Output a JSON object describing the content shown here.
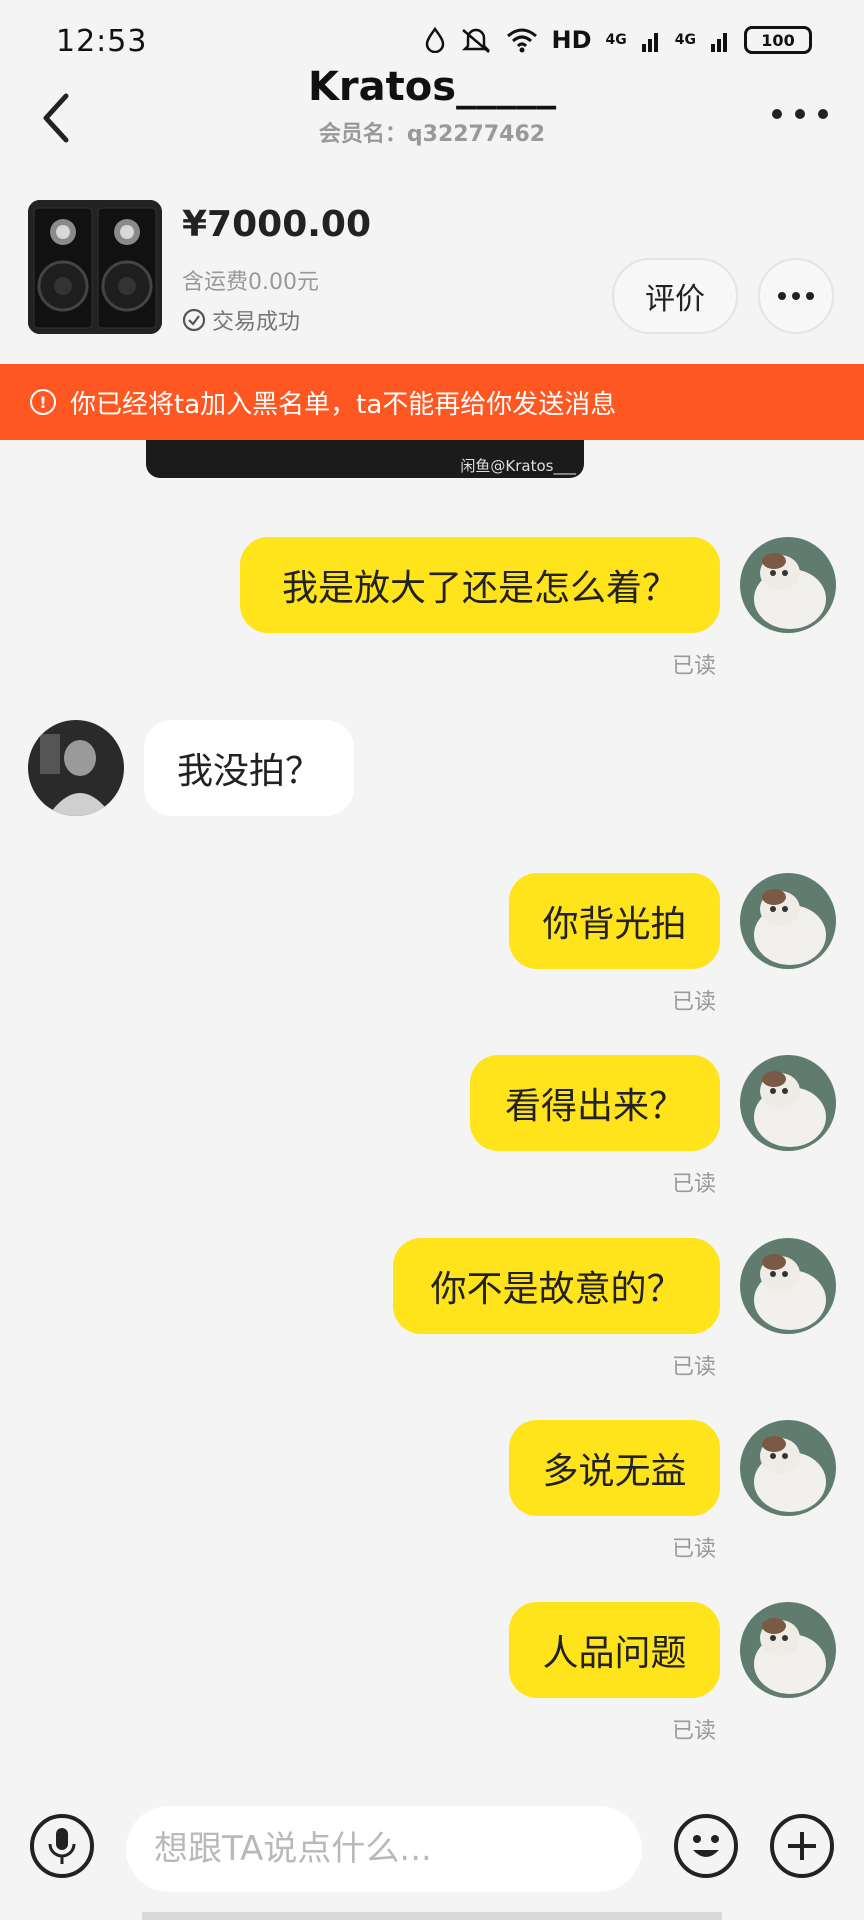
{
  "status_bar": {
    "time": "12:53",
    "signal_text": "HD",
    "net1": "4G",
    "net2": "4G",
    "battery": "100"
  },
  "header": {
    "title": "Kratos_____",
    "subtitle": "会员名：q32277462"
  },
  "product": {
    "price": "¥7000.00",
    "shipping": "含运费0.00元",
    "status": "交易成功",
    "eval_label": "评价"
  },
  "banner": {
    "text": "你已经将ta加入黑名单，ta不能再给你发送消息"
  },
  "image_message": {
    "watermark": "闲鱼@Kratos___"
  },
  "messages": [
    {
      "side": "mine",
      "text": "我是放大了还是怎么着？",
      "read": "已读"
    },
    {
      "side": "theirs",
      "text": "我没拍？",
      "read": ""
    },
    {
      "side": "mine",
      "text": "你背光拍",
      "read": "已读"
    },
    {
      "side": "mine",
      "text": "看得出来？",
      "read": "已读"
    },
    {
      "side": "mine",
      "text": "你不是故意的？",
      "read": "已读"
    },
    {
      "side": "mine",
      "text": "多说无益",
      "read": "已读"
    },
    {
      "side": "mine",
      "text": "人品问题",
      "read": "已读"
    }
  ],
  "input_bar": {
    "placeholder": "想跟TA说点什么..."
  },
  "colors": {
    "accent_yellow": "#ffe31b",
    "banner_orange": "#ff5722",
    "background": "#f4f4f4"
  }
}
